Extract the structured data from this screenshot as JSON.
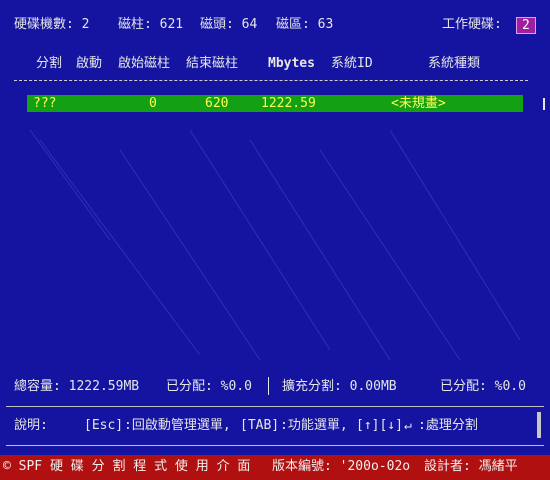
{
  "disk_info": {
    "disk_count_label": "硬碟機數: 2",
    "cylinders_label": "磁柱: 621",
    "heads_label": "磁頭: 64",
    "sectors_label": "磁區: 63",
    "work_disk_label": "工作硬碟:",
    "work_disk_value": "2"
  },
  "table": {
    "headers": [
      "分割",
      "啟動",
      "啟始磁柱",
      "結束磁柱",
      "Mbytes",
      "系統ID",
      "系統種類"
    ],
    "rows": [
      {
        "partition": "???",
        "boot": "0",
        "end_cylinder": "620",
        "mbytes": "1222.59",
        "system_type": "<未規畫>"
      }
    ]
  },
  "summary": {
    "total_capacity": "總容量: 1222.59MB",
    "allocated_left": "已分配: %0.0",
    "extended": "擴充分割: 0.00MB",
    "allocated_right": "已分配: %0.0"
  },
  "help": {
    "label": "說明:",
    "esc_key": "[Esc]",
    "esc_text": ":回啟動管理選單,",
    "tab_key": "[TAB]",
    "tab_text": ":功能選單,",
    "arrow_keys": "[↑][↓]",
    "enter_glyph": "↵",
    "enter_text": ":處理分割"
  },
  "status_bar": {
    "title": "© SPF 硬 碟 分 割 程 式 使 用 介 面",
    "version": "版本編號: '200o-02o",
    "designer": "設計者: 馮緒平"
  },
  "colors": {
    "background": "#1414a0",
    "row_highlight": "#14a014",
    "row_text": "#ffff50",
    "status_bar": "#b01010",
    "badge": "#a01ea0"
  }
}
